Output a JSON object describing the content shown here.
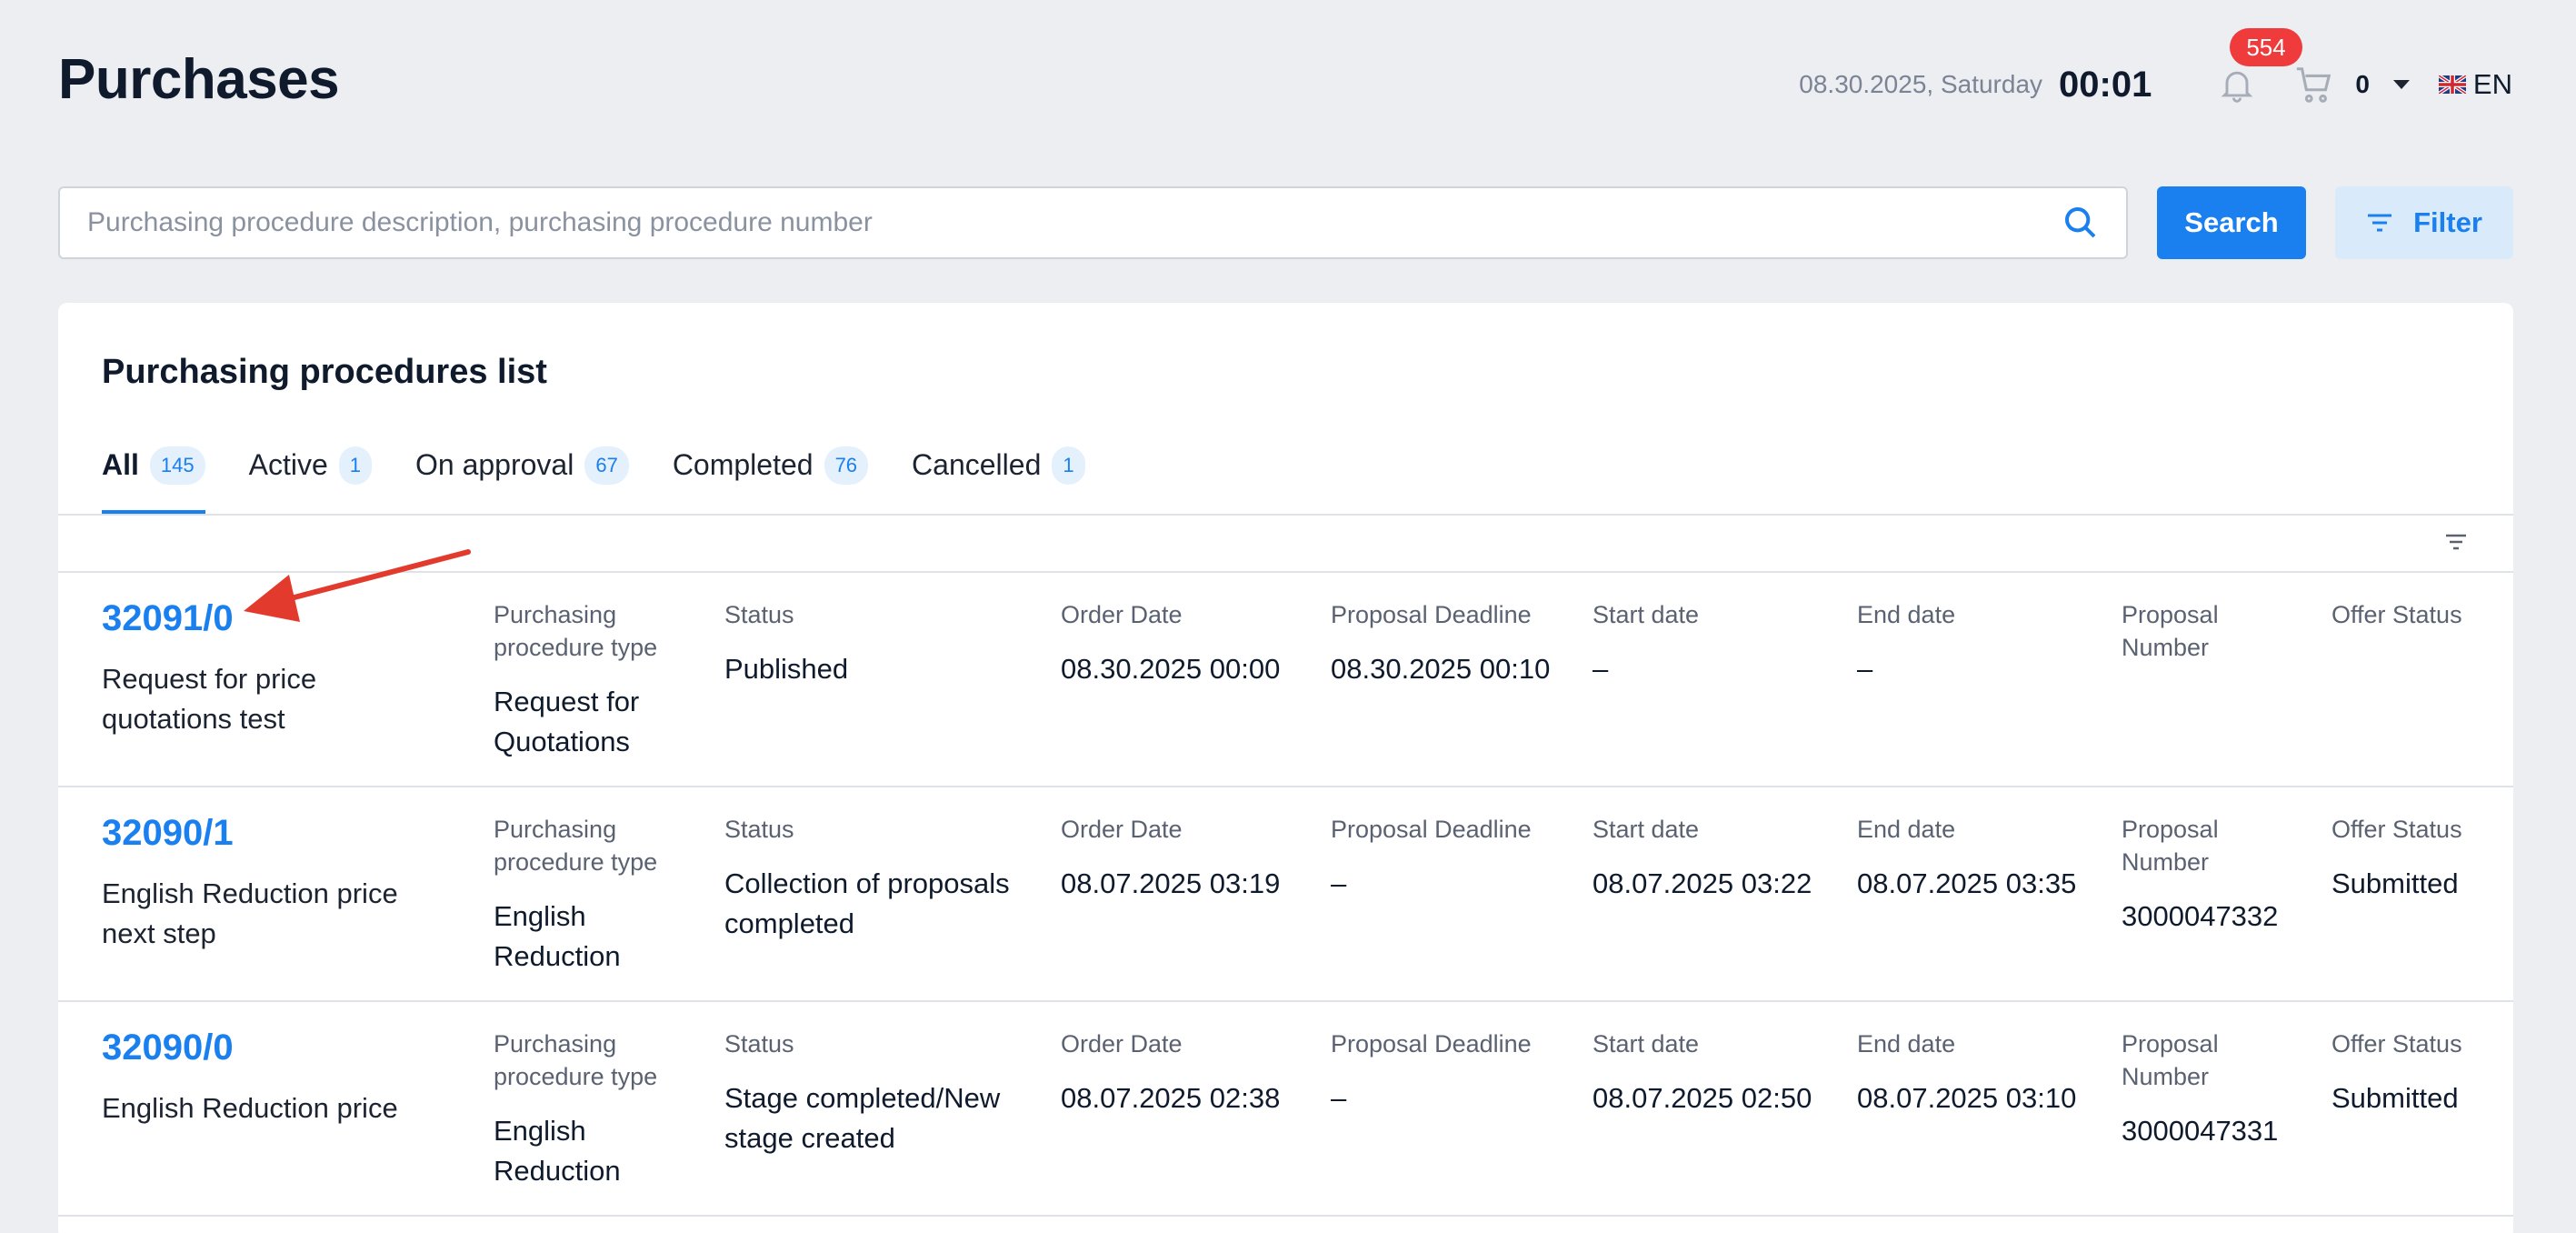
{
  "header": {
    "title": "Purchases",
    "date": "08.30.2025, Saturday",
    "time": "00:01",
    "notifications_count": "554",
    "cart_count": "0",
    "language": "EN"
  },
  "search": {
    "placeholder": "Purchasing procedure description, purchasing procedure number",
    "value": "",
    "search_label": "Search",
    "filter_label": "Filter"
  },
  "list": {
    "title": "Purchasing procedures list",
    "tabs": [
      {
        "label": "All",
        "count": "145",
        "active": true
      },
      {
        "label": "Active",
        "count": "1"
      },
      {
        "label": "On approval",
        "count": "67"
      },
      {
        "label": "Completed",
        "count": "76"
      },
      {
        "label": "Cancelled",
        "count": "1"
      }
    ],
    "column_labels": {
      "type": "Purchasing procedure type",
      "status": "Status",
      "order_date": "Order Date",
      "deadline": "Proposal Deadline",
      "start": "Start date",
      "end": "End date",
      "proposal_number": "Proposal Number",
      "offer_status": "Offer Status"
    },
    "rows": [
      {
        "number": "32091/0",
        "description": "Request for price quotations test",
        "type": "Request for Quotations",
        "status": "Published",
        "order_date": "08.30.2025 00:00",
        "deadline": "08.30.2025 00:10",
        "start": "–",
        "end": "–",
        "proposal_number": "",
        "offer_status": ""
      },
      {
        "number": "32090/1",
        "description": "English Reduction price next step",
        "type": "English Reduction",
        "status": "Collection of proposals completed",
        "order_date": "08.07.2025 03:19",
        "deadline": "–",
        "start": "08.07.2025 03:22",
        "end": "08.07.2025 03:35",
        "proposal_number": "3000047332",
        "offer_status": "Submitted"
      },
      {
        "number": "32090/0",
        "description": "English Reduction price",
        "type": "English Reduction",
        "status": "Stage completed/New stage created",
        "order_date": "08.07.2025 02:38",
        "deadline": "–",
        "start": "08.07.2025 02:50",
        "end": "08.07.2025 03:10",
        "proposal_number": "3000047331",
        "offer_status": "Submitted"
      }
    ]
  },
  "colors": {
    "accent": "#1a7fef",
    "badge": "#ef3b3b",
    "annotation_arrow": "#e23b2e"
  }
}
